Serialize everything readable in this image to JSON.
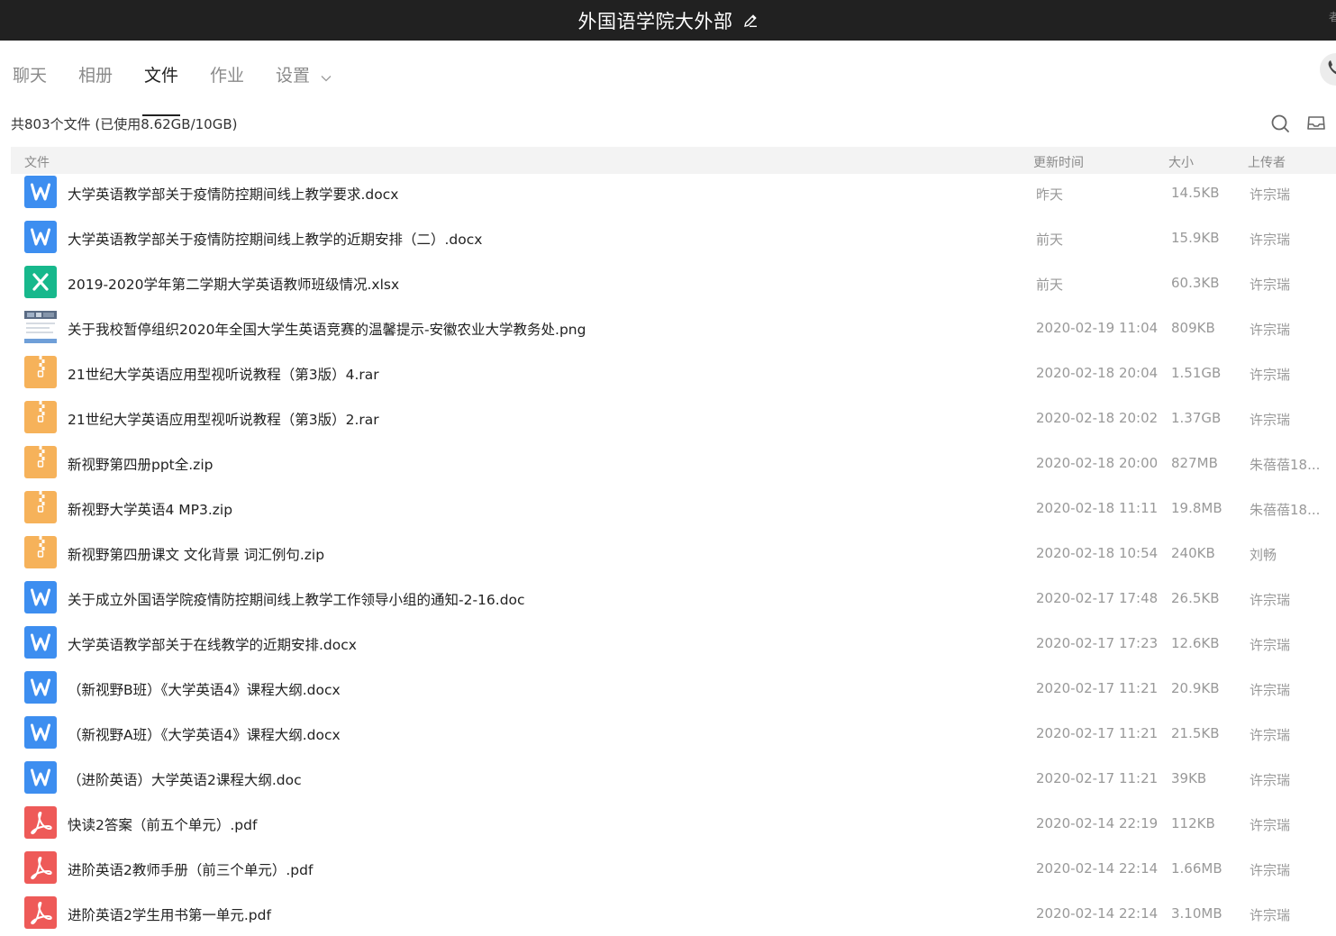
{
  "window": {
    "title": "外国语学院大外部",
    "corner_text": "者"
  },
  "tabs": [
    {
      "label": "聊天",
      "active": false
    },
    {
      "label": "相册",
      "active": false
    },
    {
      "label": "文件",
      "active": true
    },
    {
      "label": "作业",
      "active": false
    },
    {
      "label": "设置",
      "active": false,
      "has_dropdown": true
    }
  ],
  "summary": "共803个文件 (已使用8.62GB/10GB)",
  "toolbar": {
    "search_icon": "search-icon",
    "inbox_icon": "inbox-icon"
  },
  "table": {
    "headers": {
      "name": "文件",
      "time": "更新时间",
      "size": "大小",
      "uploader": "上传者"
    },
    "rows": [
      {
        "type": "word",
        "name": "大学英语教学部关于疫情防控期间线上教学要求.docx",
        "time": "昨天",
        "size": "14.5KB",
        "uploader": "许宗瑞"
      },
      {
        "type": "word",
        "name": "大学英语教学部关于疫情防控期间线上教学的近期安排（二）.docx",
        "time": "前天",
        "size": "15.9KB",
        "uploader": "许宗瑞"
      },
      {
        "type": "excel",
        "name": "2019-2020学年第二学期大学英语教师班级情况.xlsx",
        "time": "前天",
        "size": "60.3KB",
        "uploader": "许宗瑞"
      },
      {
        "type": "image",
        "name": "关于我校暂停组织2020年全国大学生英语竞赛的温馨提示-安徽农业大学教务处.png",
        "time": "2020-02-19 11:04",
        "size": "809KB",
        "uploader": "许宗瑞"
      },
      {
        "type": "zip",
        "name": "21世纪大学英语应用型视听说教程（第3版）4.rar",
        "time": "2020-02-18 20:04",
        "size": "1.51GB",
        "uploader": "许宗瑞"
      },
      {
        "type": "zip",
        "name": "21世纪大学英语应用型视听说教程（第3版）2.rar",
        "time": "2020-02-18 20:02",
        "size": "1.37GB",
        "uploader": "许宗瑞"
      },
      {
        "type": "zip",
        "name": "新视野第四册ppt全.zip",
        "time": "2020-02-18 20:00",
        "size": "827MB",
        "uploader": "朱蓓蓓18..."
      },
      {
        "type": "zip",
        "name": "新视野大学英语4 MP3.zip",
        "time": "2020-02-18 11:11",
        "size": "19.8MB",
        "uploader": "朱蓓蓓18..."
      },
      {
        "type": "zip",
        "name": "新视野第四册课文 文化背景 词汇例句.zip",
        "time": "2020-02-18 10:54",
        "size": "240KB",
        "uploader": "刘畅"
      },
      {
        "type": "word",
        "name": "关于成立外国语学院疫情防控期间线上教学工作领导小组的通知-2-16.doc",
        "time": "2020-02-17 17:48",
        "size": "26.5KB",
        "uploader": "许宗瑞"
      },
      {
        "type": "word",
        "name": "大学英语教学部关于在线教学的近期安排.docx",
        "time": "2020-02-17 17:23",
        "size": "12.6KB",
        "uploader": "许宗瑞"
      },
      {
        "type": "word",
        "name": "（新视野B班）《大学英语4》课程大纲.docx",
        "time": "2020-02-17 11:21",
        "size": "20.9KB",
        "uploader": "许宗瑞"
      },
      {
        "type": "word",
        "name": "（新视野A班）《大学英语4》课程大纲.docx",
        "time": "2020-02-17 11:21",
        "size": "21.5KB",
        "uploader": "许宗瑞"
      },
      {
        "type": "word",
        "name": "（进阶英语）大学英语2课程大纲.doc",
        "time": "2020-02-17 11:21",
        "size": "39KB",
        "uploader": "许宗瑞"
      },
      {
        "type": "pdf",
        "name": "快读2答案（前五个单元）.pdf",
        "time": "2020-02-14 22:19",
        "size": "112KB",
        "uploader": "许宗瑞"
      },
      {
        "type": "pdf",
        "name": "进阶英语2教师手册（前三个单元）.pdf",
        "time": "2020-02-14 22:14",
        "size": "1.66MB",
        "uploader": "许宗瑞"
      },
      {
        "type": "pdf",
        "name": "进阶英语2学生用书第一单元.pdf",
        "time": "2020-02-14 22:14",
        "size": "3.10MB",
        "uploader": "许宗瑞"
      }
    ]
  }
}
